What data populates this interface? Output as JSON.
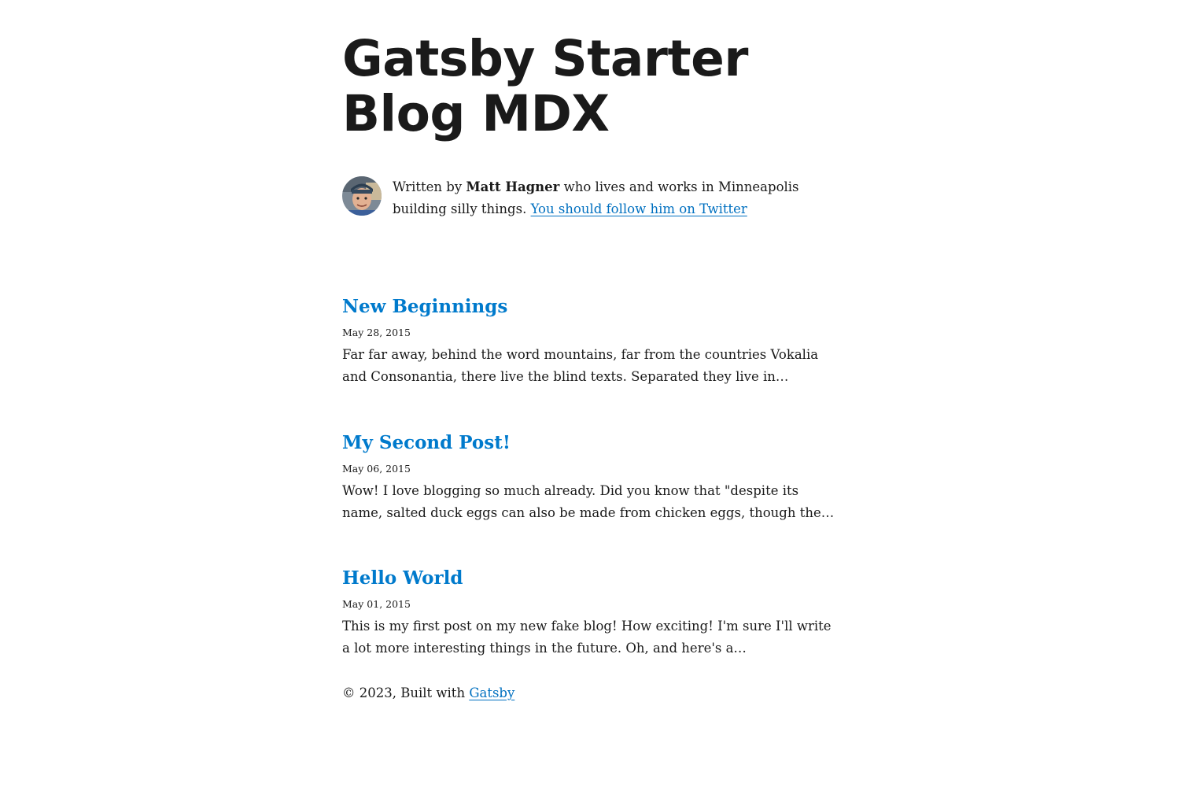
{
  "site": {
    "title_line1": "Gatsby Starter",
    "title_line2": "Blog MDX"
  },
  "bio": {
    "avatar_alt": "Matt Hagner",
    "prefix": "Written by ",
    "author": "Matt Hagner",
    "suffix": " who lives and works in Minneapolis building silly things. ",
    "twitter_link": "You should follow him on Twitter"
  },
  "posts": [
    {
      "title": "New Beginnings",
      "date": "May 28, 2015",
      "excerpt": "Far far away, behind the word mountains, far from the countries Vokalia and Consonantia, there live the blind texts. Separated they live in…"
    },
    {
      "title": "My Second Post!",
      "date": "May 06, 2015",
      "excerpt": "Wow! I love blogging so much already. Did you know that \"despite its name, salted duck eggs can also be made from chicken eggs, though the…"
    },
    {
      "title": "Hello World",
      "date": "May 01, 2015",
      "excerpt": "This is my first post on my new fake blog! How exciting! I'm sure I'll write a lot more interesting things in the future. Oh, and here's a…"
    }
  ],
  "footer": {
    "prefix": "© 2023, Built with ",
    "link": "Gatsby"
  },
  "colors": {
    "link": "#007acc",
    "text": "#1a1a1a",
    "background": "#ffffff"
  }
}
